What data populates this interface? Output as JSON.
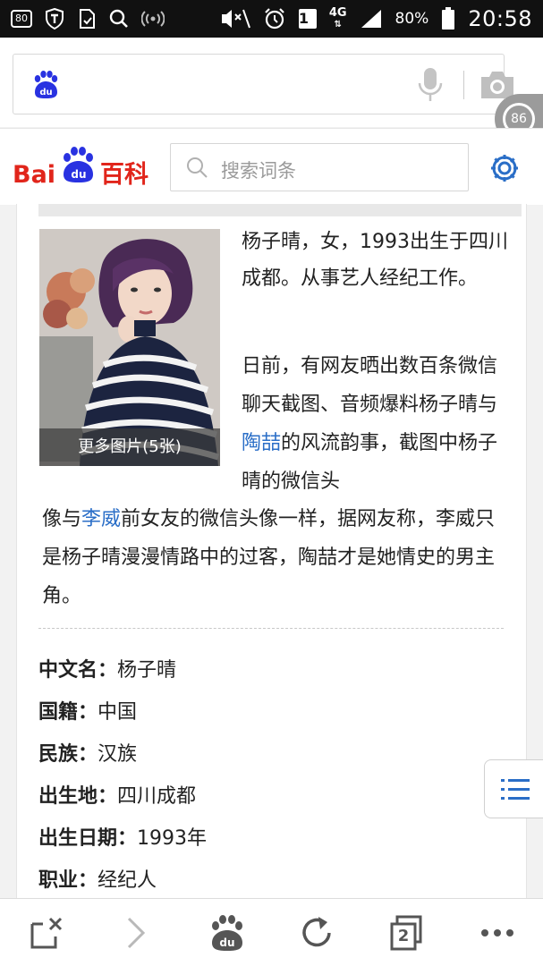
{
  "status_bar": {
    "icons": [
      "sim-80-icon",
      "shield-icon",
      "sdcard-icon",
      "search-icon",
      "signal-bars-icon",
      "mute-icon",
      "alarm-icon",
      "notification-1-icon",
      "4g-icon",
      "cellular-icon",
      "battery-icon"
    ],
    "sim_label": "80",
    "notif_count": "1",
    "network": "4G",
    "battery": "80%",
    "time": "20:58"
  },
  "browser": {
    "tab_count_badge": "86"
  },
  "baike": {
    "logo_text": "Bai百科",
    "search_placeholder": "搜索词条"
  },
  "article": {
    "photo_caption": "更多图片(5张)",
    "intro": "杨子晴，女，1993出生于四川成都。从事艺人经纪工作。",
    "news_part1": "日前，有网友晒出数百条微信聊天截图、音频爆料杨子晴与",
    "news_link1": "陶喆",
    "news_part2": "的风流韵事，截图中杨子晴的微信头",
    "news_part3": "像与",
    "news_link2": "李威",
    "news_part4": "前女友的微信头像一样，据网友称，李威只是杨子晴漫漫情路中的过客，陶喆才是她情史的男主角。"
  },
  "infobox": [
    {
      "key": "中文名：",
      "value": "杨子晴"
    },
    {
      "key": "国籍：",
      "value": "中国"
    },
    {
      "key": "民族：",
      "value": "汉族"
    },
    {
      "key": "出生地：",
      "value": "四川成都"
    },
    {
      "key": "出生日期：",
      "value": "1993年"
    },
    {
      "key": "职业：",
      "value": "经纪人"
    }
  ],
  "bottom_bar": {
    "tabs_count": "2"
  },
  "colors": {
    "brand_blue": "#2a6ec7",
    "baidu_red": "#e1251b",
    "baidu_blue": "#2932e1"
  }
}
